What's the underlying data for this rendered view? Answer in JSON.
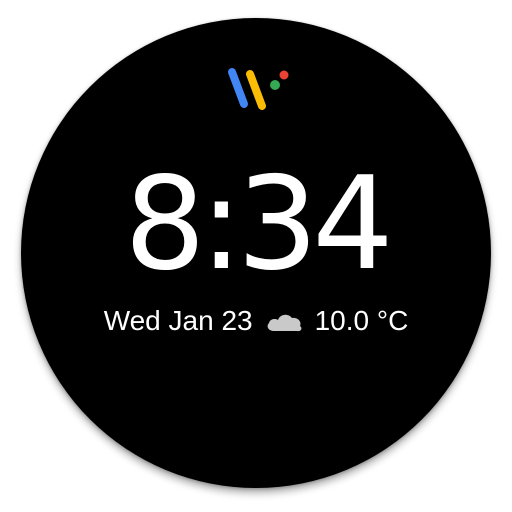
{
  "watch": {
    "time": "8:34",
    "date": "Wed Jan 23",
    "temperature": "10.0 °C",
    "weather_icon": "cloud-icon",
    "logo_icon": "wear-os-logo-icon"
  },
  "colors": {
    "face_background": "#000000",
    "text": "#ffffff",
    "logo_blue": "#4285F4",
    "logo_yellow": "#FBBC05",
    "logo_green": "#34A853",
    "logo_red": "#EA4335",
    "cloud": "#c9c9c9"
  }
}
